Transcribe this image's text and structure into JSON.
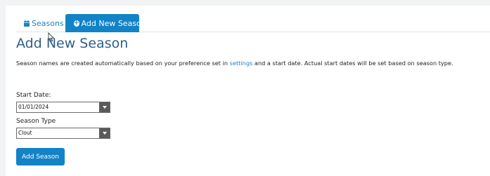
{
  "tabs": [
    {
      "label": "Seasons",
      "icon": "calendar-icon",
      "active": false
    },
    {
      "label": "Add New Season",
      "icon": "plus-circle-icon",
      "active": true
    }
  ],
  "page_title": "Add New Season",
  "description": {
    "before": "Season names are created automatically based on your preference set in ",
    "link": "settings",
    "after": " and a start date. Actual start dates will be set based on season type."
  },
  "start_date": {
    "label": "Start Date:",
    "value": "01/01/2024"
  },
  "season_type": {
    "label": "Season Type",
    "value": "Clout"
  },
  "submit_label": "Add Season",
  "colors": {
    "accent": "#1283c6",
    "title": "#2e5e8e",
    "link": "#1c82c4"
  }
}
